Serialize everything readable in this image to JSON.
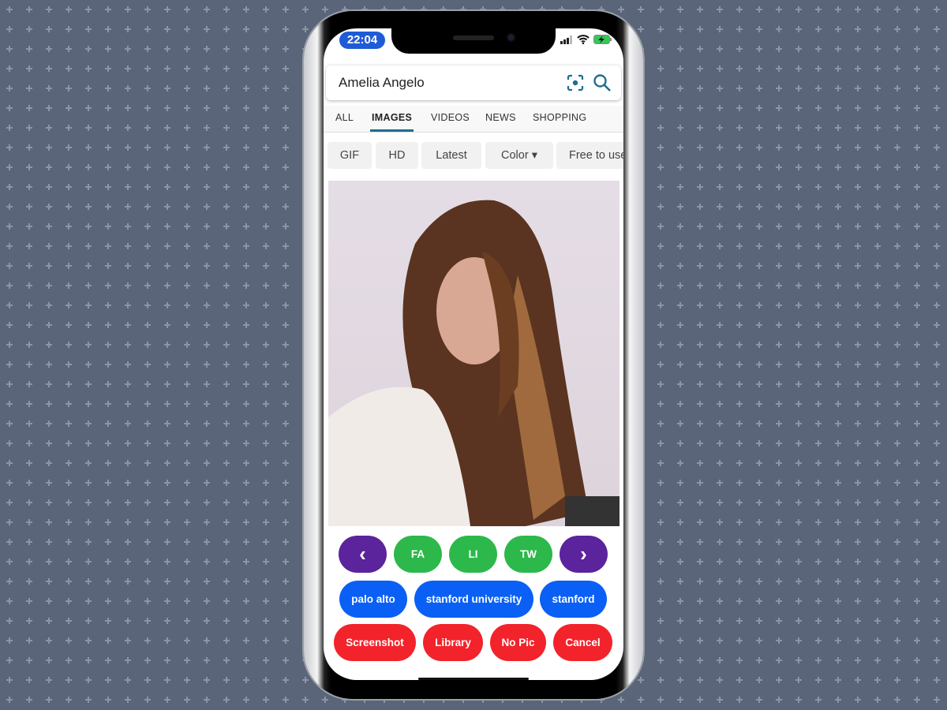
{
  "status_bar": {
    "time": "22:04"
  },
  "search": {
    "query": "Amelia Angelo",
    "lens_icon": "camera-lens-icon",
    "search_icon": "magnifier-icon"
  },
  "tabs": [
    {
      "label": "ALL"
    },
    {
      "label": "IMAGES",
      "active": true
    },
    {
      "label": "VIDEOS"
    },
    {
      "label": "NEWS"
    },
    {
      "label": "SHOPPING"
    }
  ],
  "filters": [
    {
      "label": "GIF"
    },
    {
      "label": "HD"
    },
    {
      "label": "Latest"
    },
    {
      "label": "Color ▾"
    },
    {
      "label": "Free to use"
    }
  ],
  "actions": {
    "row1": [
      {
        "label": "‹",
        "color": "#5b239c"
      },
      {
        "label": "FA",
        "color": "#2db84b"
      },
      {
        "label": "LI",
        "color": "#2db84b"
      },
      {
        "label": "TW",
        "color": "#2db84b"
      },
      {
        "label": "›",
        "color": "#5b239c"
      }
    ],
    "row2": [
      {
        "label": "palo alto"
      },
      {
        "label": "stanford university"
      },
      {
        "label": "stanford"
      }
    ],
    "row3": [
      {
        "label": "Screenshot"
      },
      {
        "label": "Library"
      },
      {
        "label": "No Pic"
      },
      {
        "label": "Cancel"
      }
    ]
  },
  "colors": {
    "purple": "#5b239c",
    "green": "#2db84b",
    "blue": "#0a5ff5",
    "red": "#f2232b",
    "accent": "#1e6e8e"
  }
}
